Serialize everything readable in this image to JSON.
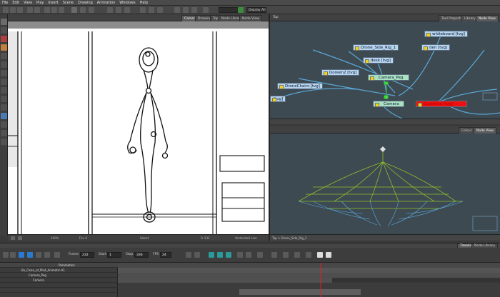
{
  "menubar": [
    "File",
    "Edit",
    "View",
    "Play",
    "Insert",
    "Scene",
    "Drawing",
    "Animation",
    "Windows",
    "Help"
  ],
  "toolbar": {
    "display_select": "Display All"
  },
  "camera_panel": {
    "tabs": [
      "Camera",
      "Drawing",
      "Top",
      "Node Library",
      "Node View"
    ],
    "status": {
      "zoom": "100%",
      "fov": "Fov 4",
      "mode": "Select",
      "frame": "Fr 232",
      "vector": "Vectorized Line"
    }
  },
  "node_panel": {
    "tabs": [
      "Tool Properties",
      "Library",
      "Node View"
    ],
    "nodes": [
      {
        "label": "whiteboard [tvg]",
        "kind": "blue"
      },
      {
        "label": "Drone_Side_Rig_1",
        "kind": "blue"
      },
      {
        "label": "den [tvg]",
        "kind": "blue"
      },
      {
        "label": "desk [tvg]",
        "kind": "blue"
      },
      {
        "label": "Doreen2 [tvg]",
        "kind": "blue"
      },
      {
        "label": "Camera_Peg",
        "kind": "green"
      },
      {
        "label": "DroneChairs [tvg]",
        "kind": "blue"
      },
      {
        "label": "[tvg]",
        "kind": "blue"
      },
      {
        "label": "Camera",
        "kind": "green"
      },
      {
        "label": "Guideline [tvg]",
        "kind": "red"
      }
    ],
    "breadcrumb": "Top"
  },
  "node_panel2": {
    "tabs": [
      "Colour",
      "Node View"
    ],
    "breadcrumb": "Top > Drone_Side_Rig_1"
  },
  "timeline": {
    "tabs": [
      "Timeline",
      "Node Library"
    ],
    "frame_label": "Frame",
    "frame": "232",
    "start_label": "Start",
    "start": "1",
    "stop_label": "Stop",
    "stop": "336",
    "fps_label": "FPS",
    "fps": "24",
    "layers_header": "Parameters",
    "layers": [
      {
        "name": "Bo_Close_of_Pilot_Animatic-A1"
      },
      {
        "name": "Camera_Peg"
      },
      {
        "name": "Camera"
      },
      {
        "name": ""
      },
      {
        "name": ""
      }
    ]
  }
}
